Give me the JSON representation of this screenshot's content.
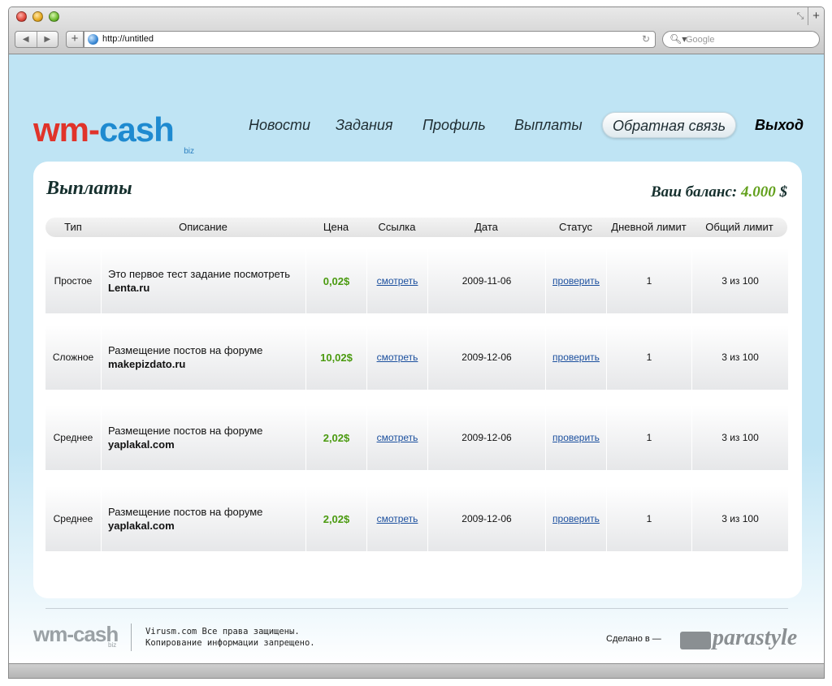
{
  "browser": {
    "url": "http://untitled",
    "search_placeholder": "Google"
  },
  "logo": {
    "wm": "wm-",
    "cash": "cash",
    "biz": "biz"
  },
  "menu": [
    {
      "label": "Новости"
    },
    {
      "label": "Задания"
    },
    {
      "label": "Профиль"
    },
    {
      "label": "Выплаты"
    },
    {
      "label": "Обратная связь"
    },
    {
      "label": "Выход"
    }
  ],
  "page_title": "Выплаты",
  "balance": {
    "label": "Ваш баланс:",
    "value": "4.000",
    "currency": "$"
  },
  "table": {
    "headers": [
      "Тип",
      "Описание",
      "Цена",
      "Ссылка",
      "Дата",
      "Статус",
      "Дневной лимит",
      "Общий лимит"
    ],
    "rows": [
      {
        "type": "Простое",
        "desc": "Это первое тест задание посмотреть",
        "site": "Lenta.ru",
        "price": "0,02$",
        "link": "смотреть",
        "date": "2009-11-06",
        "status": "проверить",
        "daily": "1",
        "total": "3 из 100"
      },
      {
        "type": "Сложное",
        "desc": "Размещение постов на форуме",
        "site": "makepizdato.ru",
        "price": "10,02$",
        "link": "смотреть",
        "date": "2009-12-06",
        "status": "проверить",
        "daily": "1",
        "total": "3 из 100"
      },
      {
        "type": "Среднее",
        "desc": "Размещение постов на форуме",
        "site": "yaplakal.com",
        "price": "2,02$",
        "link": "смотреть",
        "date": "2009-12-06",
        "status": "проверить",
        "daily": "1",
        "total": "3 из 100"
      },
      {
        "type": "Среднее",
        "desc": "Размещение постов на форуме",
        "site": "yaplakal.com",
        "price": "2,02$",
        "link": "смотреть",
        "date": "2009-12-06",
        "status": "проверить",
        "daily": "1",
        "total": "3 из 100"
      }
    ]
  },
  "footer": {
    "logo": "wm-cash",
    "logo_biz": "biz",
    "copyright_line1": "Virusm.com Все права защищены.",
    "copyright_line2": "Копирование информации запрещено.",
    "made_by": "Сделано в —",
    "studio": "parastyle"
  }
}
